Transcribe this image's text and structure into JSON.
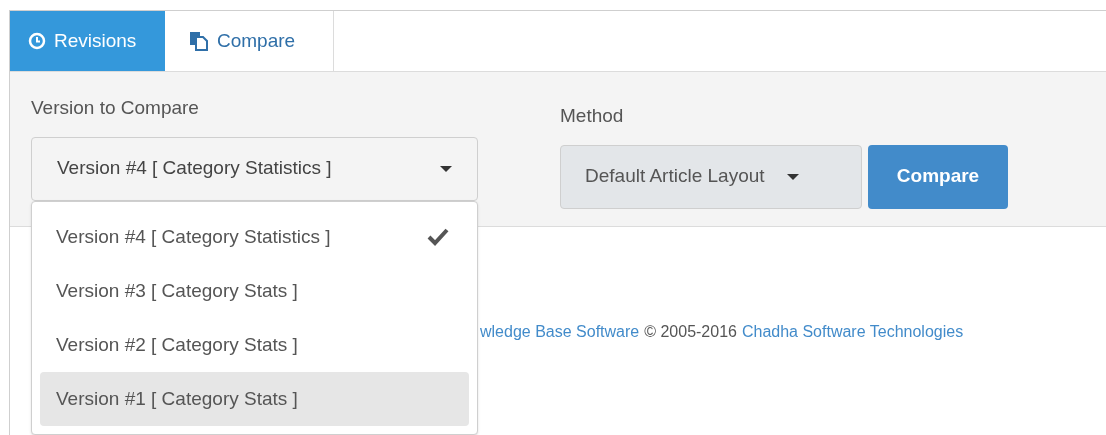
{
  "tabs": [
    {
      "label": "Revisions",
      "kind": "history",
      "selected": true
    },
    {
      "label": "Compare",
      "kind": "compare",
      "selected": false
    }
  ],
  "version_field": {
    "label": "Version to Compare",
    "value": "Version #4 [ Category Statistics ]"
  },
  "version_menu": [
    {
      "label": "Version #4 [ Category Statistics ]",
      "selected": true,
      "highlighted": false
    },
    {
      "label": "Version #3 [ Category Stats ]",
      "selected": false,
      "highlighted": false
    },
    {
      "label": "Version #2 [ Category Stats ]",
      "selected": false,
      "highlighted": false
    },
    {
      "label": "Version #1 [ Category Stats ]",
      "selected": false,
      "highlighted": true
    }
  ],
  "method_field": {
    "label": "Method",
    "value": "Default Article Layout"
  },
  "compare_button": "Compare",
  "footer": {
    "link_1": "wledge Base Software",
    "text": "© 2005-2016",
    "link_2": "Chadha Software Technologies"
  }
}
